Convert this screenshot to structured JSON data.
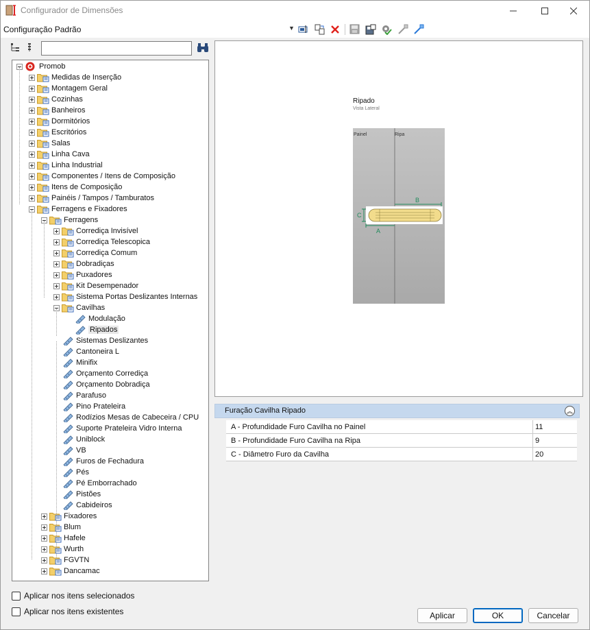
{
  "window": {
    "title": "Configurador de Dimensões"
  },
  "toolbar": {
    "configuration": "Configuração Padrão",
    "buttons": [
      "rename-config-icon",
      "copy-config-icon",
      "delete-icon",
      "save-icon",
      "save-as-icon",
      "apply-settings-icon",
      "pick-dimension-icon",
      "edit-dimension-icon"
    ]
  },
  "tree": {
    "rows": [
      {
        "label": "Promob",
        "level": 0,
        "exp": "minus",
        "icon": "root"
      },
      {
        "label": "Medidas de Inserção",
        "level": 1,
        "exp": "plus",
        "icon": "folder"
      },
      {
        "label": "Montagem Geral",
        "level": 1,
        "exp": "plus",
        "icon": "folder"
      },
      {
        "label": "Cozinhas",
        "level": 1,
        "exp": "plus",
        "icon": "folder"
      },
      {
        "label": "Banheiros",
        "level": 1,
        "exp": "plus",
        "icon": "folder"
      },
      {
        "label": "Dormitórios",
        "level": 1,
        "exp": "plus",
        "icon": "folder"
      },
      {
        "label": "Escritórios",
        "level": 1,
        "exp": "plus",
        "icon": "folder"
      },
      {
        "label": "Salas",
        "level": 1,
        "exp": "plus",
        "icon": "folder"
      },
      {
        "label": "Linha Cava",
        "level": 1,
        "exp": "plus",
        "icon": "folder"
      },
      {
        "label": "Linha Industrial",
        "level": 1,
        "exp": "plus",
        "icon": "folder"
      },
      {
        "label": "Componentes / Itens de Composição",
        "level": 1,
        "exp": "plus",
        "icon": "folder"
      },
      {
        "label": "Itens de Composição",
        "level": 1,
        "exp": "plus",
        "icon": "folder"
      },
      {
        "label": "Painéis / Tampos / Tamburatos",
        "level": 1,
        "exp": "plus",
        "icon": "folder"
      },
      {
        "label": "Ferragens e Fixadores",
        "level": 1,
        "exp": "minus",
        "icon": "folder"
      },
      {
        "label": "Ferragens",
        "level": 2,
        "exp": "minus",
        "icon": "folder"
      },
      {
        "label": "Corrediça Invisível",
        "level": 3,
        "exp": "plus",
        "icon": "folder"
      },
      {
        "label": "Corrediça Telescopica",
        "level": 3,
        "exp": "plus",
        "icon": "folder"
      },
      {
        "label": "Corrediça Comum",
        "level": 3,
        "exp": "plus",
        "icon": "folder"
      },
      {
        "label": "Dobradiças",
        "level": 3,
        "exp": "plus",
        "icon": "folder"
      },
      {
        "label": "Puxadores",
        "level": 3,
        "exp": "plus",
        "icon": "folder"
      },
      {
        "label": "Kit Desempenador",
        "level": 3,
        "exp": "plus",
        "icon": "folder"
      },
      {
        "label": "Sistema Portas Deslizantes Internas",
        "level": 3,
        "exp": "plus",
        "icon": "folder"
      },
      {
        "label": "Cavilhas",
        "level": 3,
        "exp": "minus",
        "icon": "folder"
      },
      {
        "label": "Modulação",
        "level": 4,
        "exp": "none",
        "icon": "item"
      },
      {
        "label": "Ripados",
        "level": 4,
        "exp": "none",
        "icon": "item",
        "selected": true
      },
      {
        "label": "Sistemas Deslizantes",
        "level": 3,
        "exp": "none",
        "icon": "item"
      },
      {
        "label": "Cantoneira L",
        "level": 3,
        "exp": "none",
        "icon": "item"
      },
      {
        "label": "Minifix",
        "level": 3,
        "exp": "none",
        "icon": "item"
      },
      {
        "label": "Orçamento Corrediça",
        "level": 3,
        "exp": "none",
        "icon": "item"
      },
      {
        "label": "Orçamento Dobradiça",
        "level": 3,
        "exp": "none",
        "icon": "item"
      },
      {
        "label": "Parafuso",
        "level": 3,
        "exp": "none",
        "icon": "item"
      },
      {
        "label": "Pino Prateleira",
        "level": 3,
        "exp": "none",
        "icon": "item"
      },
      {
        "label": "Rodízios Mesas de Cabeceira / CPU",
        "level": 3,
        "exp": "none",
        "icon": "item"
      },
      {
        "label": "Suporte Prateleira Vidro Interna",
        "level": 3,
        "exp": "none",
        "icon": "item"
      },
      {
        "label": "Uniblock",
        "level": 3,
        "exp": "none",
        "icon": "item"
      },
      {
        "label": "VB",
        "level": 3,
        "exp": "none",
        "icon": "item"
      },
      {
        "label": "Furos de Fechadura",
        "level": 3,
        "exp": "none",
        "icon": "item"
      },
      {
        "label": "Pés",
        "level": 3,
        "exp": "none",
        "icon": "item"
      },
      {
        "label": "Pé Emborrachado",
        "level": 3,
        "exp": "none",
        "icon": "item"
      },
      {
        "label": "Pistões",
        "level": 3,
        "exp": "none",
        "icon": "item"
      },
      {
        "label": "Cabideiros",
        "level": 3,
        "exp": "none",
        "icon": "item"
      },
      {
        "label": "Fixadores",
        "level": 2,
        "exp": "plus",
        "icon": "folder"
      },
      {
        "label": "Blum",
        "level": 2,
        "exp": "plus",
        "icon": "folder"
      },
      {
        "label": "Hafele",
        "level": 2,
        "exp": "plus",
        "icon": "folder"
      },
      {
        "label": "Wurth",
        "level": 2,
        "exp": "plus",
        "icon": "folder"
      },
      {
        "label": "FGVTN",
        "level": 2,
        "exp": "plus",
        "icon": "folder"
      },
      {
        "label": "Dancamac",
        "level": 2,
        "exp": "plus",
        "icon": "folder"
      }
    ]
  },
  "drawing": {
    "title": "Ripado",
    "subtitle": "Vista Lateral",
    "panel_label": "Painel",
    "slat_label": "Ripa",
    "dim_a": "A",
    "dim_b": "B",
    "dim_c": "C"
  },
  "properties": {
    "section_title": "Furação Cavilha Ripado",
    "rows": [
      {
        "name": "A - Profundidade Furo Cavilha no Painel",
        "value": "11"
      },
      {
        "name": "B - Profundidade Furo Cavilha na Ripa",
        "value": "9"
      },
      {
        "name": "C - Diâmetro Furo da Cavilha",
        "value": "20"
      }
    ]
  },
  "options": {
    "apply_selected": "Aplicar nos itens selecionados",
    "apply_existing": "Aplicar nos itens existentes"
  },
  "buttons": {
    "apply": "Aplicar",
    "ok": "OK",
    "cancel": "Cancelar"
  },
  "colors": {
    "accent": "#0067c0",
    "section_header": "#c5d8ee",
    "dimension_green": "#1f8a5a",
    "dowel_fill": "#f2dc8c"
  }
}
